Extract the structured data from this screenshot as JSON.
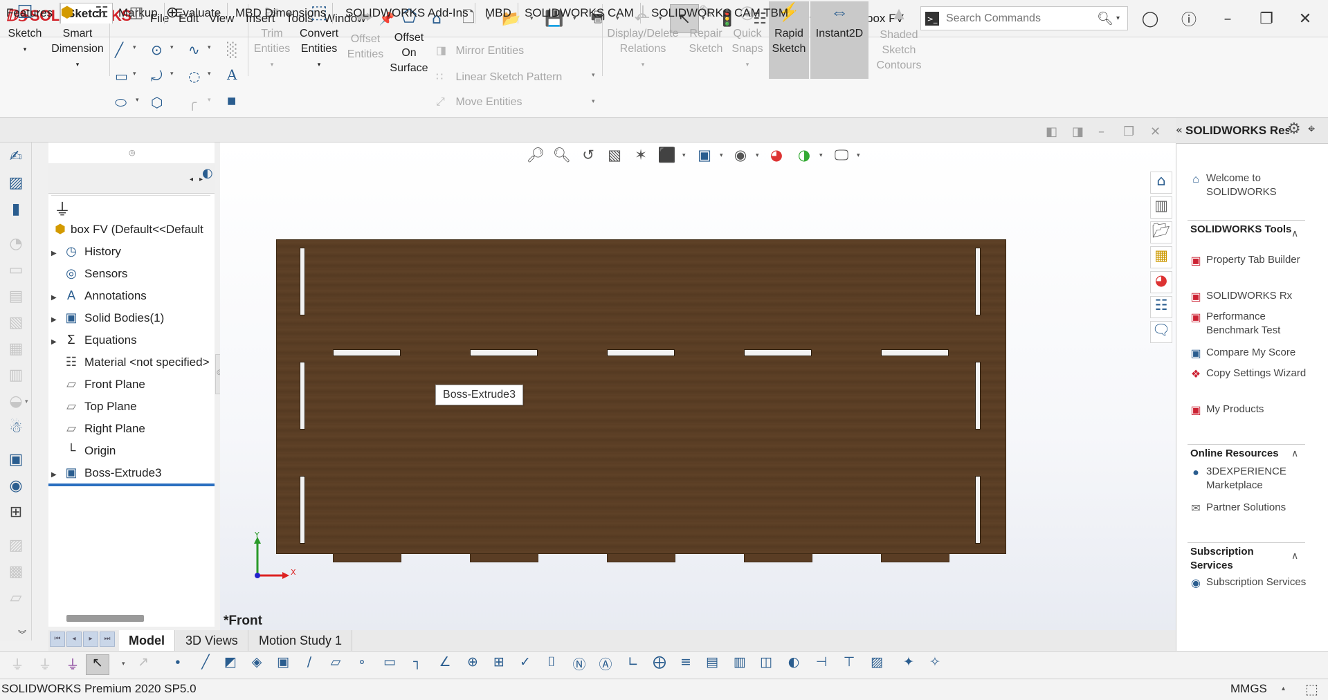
{
  "app": {
    "brand": "SOLIDWORKS",
    "document_title": "box FV",
    "colors": {
      "brand": "#d2232a",
      "accent": "#2a5d8f",
      "selection": "#2a6fc0",
      "board": "#5a3d24"
    }
  },
  "menu": [
    "File",
    "Edit",
    "View",
    "Insert",
    "Tools",
    "Window"
  ],
  "search": {
    "placeholder": "Search Commands"
  },
  "command_manager": {
    "sketch": "Sketch",
    "smart_dimension": [
      "Smart",
      "Dimension"
    ],
    "trim": [
      "Trim",
      "Entities"
    ],
    "convert": [
      "Convert",
      "Entities"
    ],
    "offset": [
      "Offset",
      "Entities"
    ],
    "offset_surface": [
      "Offset",
      "On",
      "Surface"
    ],
    "mirror": "Mirror Entities",
    "linear_pattern": "Linear Sketch Pattern",
    "move": "Move Entities",
    "display_relations": [
      "Display/Delete",
      "Relations"
    ],
    "repair": [
      "Repair",
      "Sketch"
    ],
    "quick_snaps": [
      "Quick",
      "Snaps"
    ],
    "rapid_sketch": [
      "Rapid",
      "Sketch"
    ],
    "instant2d": "Instant2D",
    "shaded_contours": [
      "Shaded",
      "Sketch",
      "Contours"
    ]
  },
  "tabs": [
    "Features",
    "Sketch",
    "Markup",
    "Evaluate",
    "MBD Dimensions",
    "SOLIDWORKS Add-Ins",
    "MBD",
    "SOLIDWORKS CAM",
    "SOLIDWORKS CAM TBM"
  ],
  "active_tab": "Sketch",
  "feature_tree": {
    "root": "box FV  (Default<<Default",
    "items": [
      {
        "label": "History",
        "expandable": true,
        "icon": "history-icon"
      },
      {
        "label": "Sensors",
        "expandable": false,
        "icon": "sensor-icon"
      },
      {
        "label": "Annotations",
        "expandable": true,
        "icon": "annotations-icon"
      },
      {
        "label": "Solid Bodies(1)",
        "expandable": true,
        "icon": "solid-bodies-icon"
      },
      {
        "label": "Equations",
        "expandable": true,
        "icon": "equations-icon"
      },
      {
        "label": "Material <not specified>",
        "expandable": false,
        "icon": "material-icon"
      },
      {
        "label": "Front Plane",
        "expandable": false,
        "icon": "plane-icon"
      },
      {
        "label": "Top Plane",
        "expandable": false,
        "icon": "plane-icon"
      },
      {
        "label": "Right Plane",
        "expandable": false,
        "icon": "plane-icon"
      },
      {
        "label": "Origin",
        "expandable": false,
        "icon": "origin-icon"
      },
      {
        "label": "Boss-Extrude3",
        "expandable": true,
        "icon": "extrude-icon"
      }
    ]
  },
  "graphics": {
    "tooltip": "Boss-Extrude3",
    "view_name": "*Front",
    "triad": {
      "y": "Y",
      "x": "X"
    }
  },
  "task_pane": {
    "title": "SOLIDWORKS Resources",
    "welcome": "Welcome to SOLIDWORKS",
    "tools_section": "SOLIDWORKS Tools",
    "tools": [
      "Property Tab Builder",
      "SOLIDWORKS Rx",
      "Performance Benchmark Test",
      "Compare My Score",
      "Copy Settings Wizard",
      "My Products"
    ],
    "online_section": "Online Resources",
    "online": [
      "3DEXPERIENCE Marketplace",
      "Partner Solutions"
    ],
    "subscription_section": "Subscription Services",
    "subscription": [
      "Subscription Services"
    ]
  },
  "bottom_tabs": [
    "Model",
    "3D Views",
    "Motion Study 1"
  ],
  "status": {
    "text": "SOLIDWORKS Premium 2020 SP5.0",
    "units": "MMGS"
  }
}
